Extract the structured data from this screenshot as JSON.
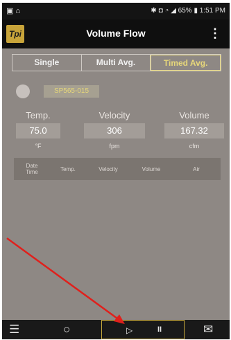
{
  "status_bar": {
    "left_icons": "▣ ⌂",
    "right_text": "✱ ◘ ◔ ◢ 65% ▮ 1:51 PM"
  },
  "app_bar": {
    "logo_text": "Tpi",
    "title": "Volume Flow",
    "menu_icon": "⋮"
  },
  "tabs": [
    {
      "label": "Single"
    },
    {
      "label": "Multi Avg."
    },
    {
      "label": "Timed Avg."
    }
  ],
  "active_tab": "Timed Avg.",
  "device": {
    "id": "SP565-015"
  },
  "readings": [
    {
      "label": "Temp.",
      "value": "75.0",
      "unit": "°F"
    },
    {
      "label": "Velocity",
      "value": "306",
      "unit": "fpm"
    },
    {
      "label": "Volume",
      "value": "167.32",
      "unit": "cfm"
    }
  ],
  "table": {
    "columns": [
      "Date\nTime",
      "Temp.",
      "Velocity",
      "Volume",
      "Air"
    ]
  },
  "bottom_bar": {
    "list_icon": "☰",
    "refresh_icon": "○",
    "play_icon": "▷",
    "pause_icon": "II",
    "mail_icon": "✉"
  },
  "colors": {
    "background": "#8e8884",
    "accent": "#e7d77a",
    "annotation_arrow": "#e0201c"
  }
}
